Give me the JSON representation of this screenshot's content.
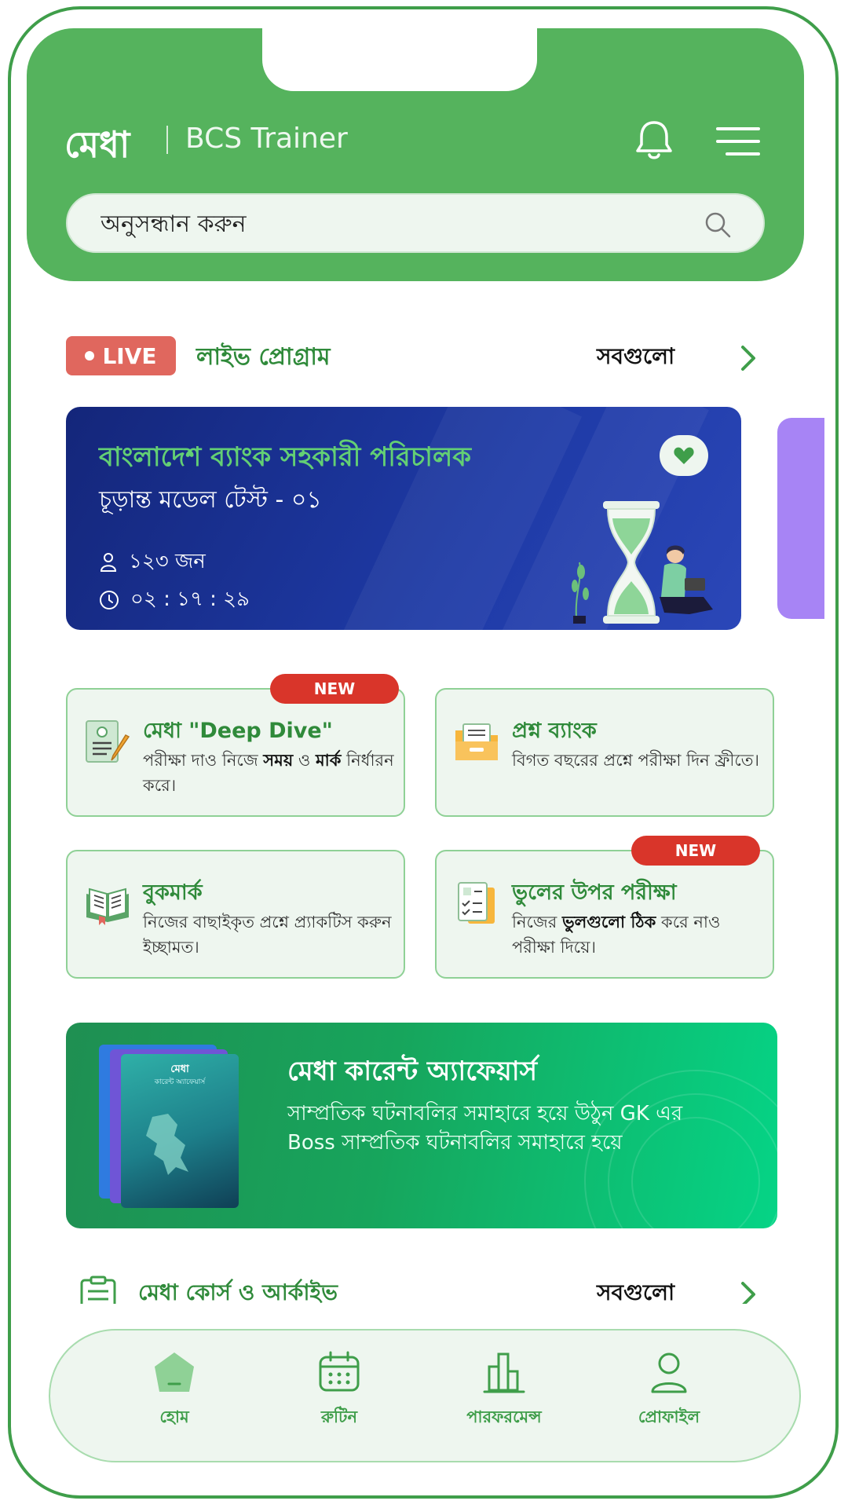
{
  "header": {
    "brand": "মেধা",
    "brand_sub": "BCS Trainer",
    "search_placeholder": "অনুসন্ধান করুন",
    "icons": [
      "bell-icon",
      "hamburger-menu-icon",
      "search-icon"
    ],
    "color": "#55b35d"
  },
  "live_section": {
    "badge": "LIVE",
    "title": "লাইভ প্রোগ্রাম",
    "see_all": "সবগুলো",
    "card": {
      "title": "বাংলাদেশ ব্যাংক সহকারী পরিচালক",
      "subtitle": "চূড়ান্ত মডেল টেস্ট - ০১",
      "participants": "১২৩ জন",
      "countdown": "০২ : ১৭ : ২৯"
    }
  },
  "features": [
    {
      "badge": "NEW",
      "title": "মেধা \"Deep Dive\"",
      "desc_parts": [
        "পরীক্ষা দাও নিজে ",
        "সময়",
        " ও ",
        "মার্ক",
        " নির্ধারন করে।"
      ],
      "icon": "deep-dive-icon"
    },
    {
      "title": "প্রশ্ন ব্যাংক",
      "desc": "বিগত বছরের প্রশ্নে পরীক্ষা দিন ফ্রীতে।",
      "icon": "folder-icon"
    },
    {
      "title": "বুকমার্ক",
      "desc": "নিজের বাছাইকৃত প্রশ্নে প্র্যাকটিস করুন ইচ্ছামত।",
      "icon": "book-icon"
    },
    {
      "badge": "NEW",
      "title": "ভুলের উপর পরীক্ষা",
      "desc_parts": [
        "নিজের ",
        "ভুলগুলো ঠিক",
        " করে নাও পরীক্ষা দিয়ে।"
      ],
      "icon": "checklist-icon"
    }
  ],
  "current_affairs": {
    "title": "মেধা কারেন্ট অ্যাফেয়ার্স",
    "desc": "সাম্প্রতিক ঘটনাবলির সমাহারে হয়ে উঠুন GK এর Boss সাম্প্রতিক ঘটনাবলির সমাহারে হয়ে",
    "book_title": "মেধা",
    "book_subtitle": "কারেন্ট অ্যাফেয়ার্স"
  },
  "courses": {
    "title": "মেধা কোর্স ও আর্কাইভ",
    "see_all": "সবগুলো"
  },
  "nav": {
    "home": "হোম",
    "routine": "রুটিন",
    "performance": "পারফরমেন্স",
    "profile": "প্রোফাইল"
  }
}
